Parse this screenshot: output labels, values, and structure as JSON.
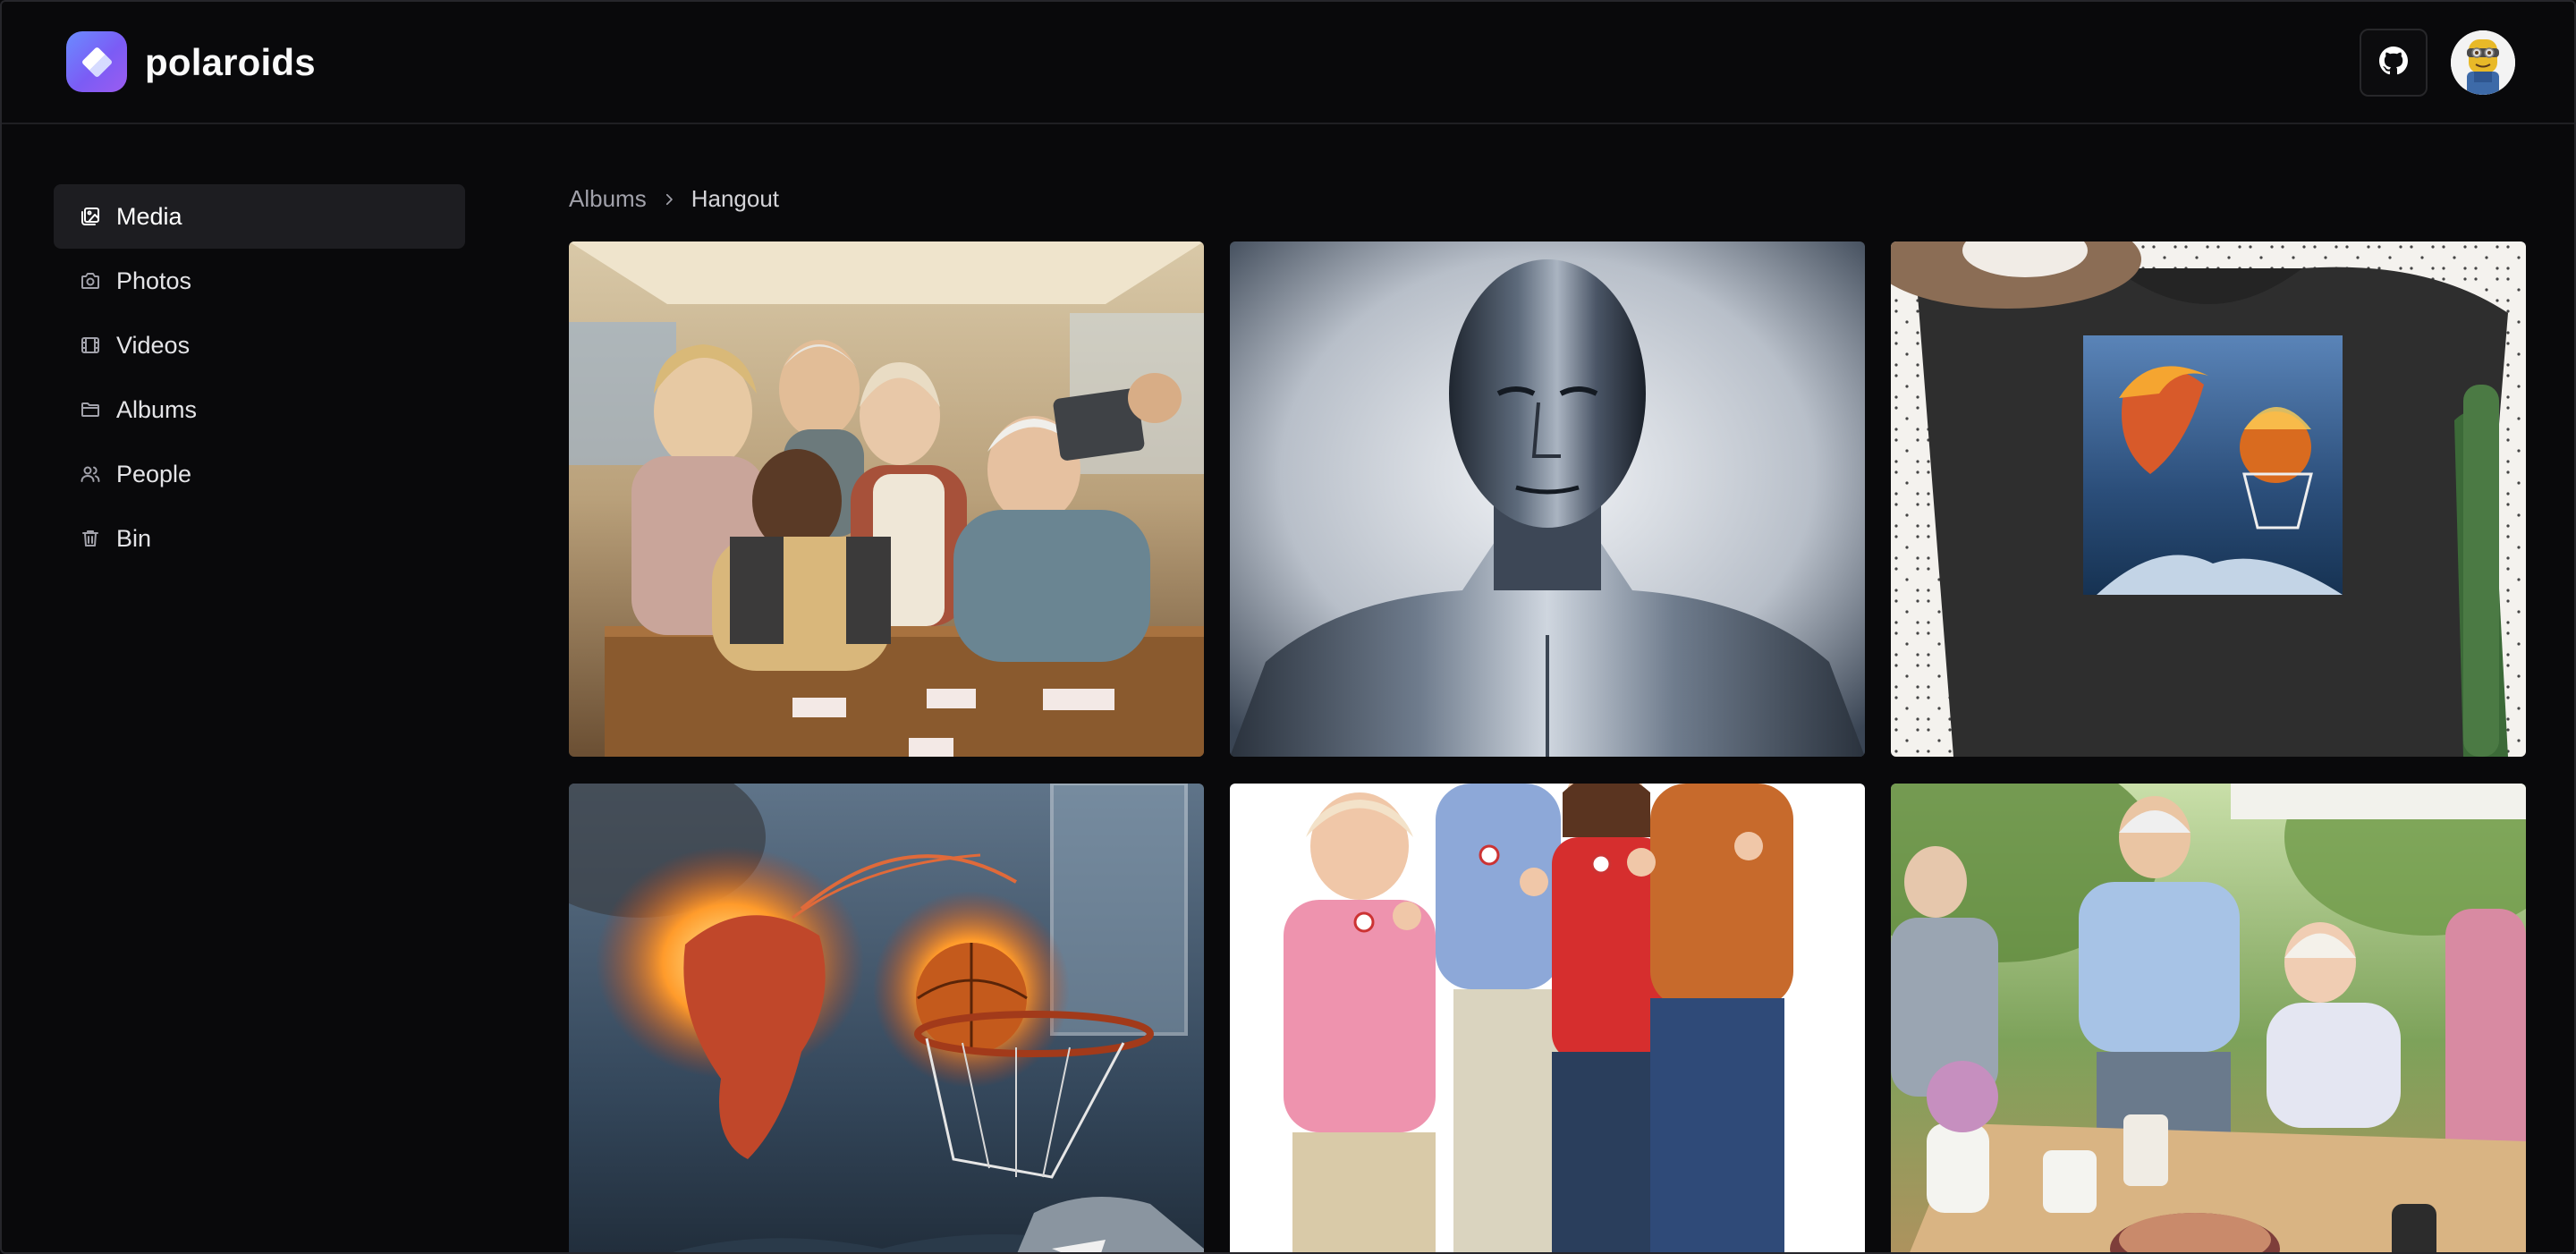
{
  "app": {
    "name": "polaroids"
  },
  "header": {
    "github_icon": "github-icon",
    "avatar_icon": "user-avatar"
  },
  "sidebar": {
    "items": [
      {
        "label": "Media",
        "icon": "media-icon",
        "active": true
      },
      {
        "label": "Photos",
        "icon": "camera-icon",
        "active": false
      },
      {
        "label": "Videos",
        "icon": "film-icon",
        "active": false
      },
      {
        "label": "Albums",
        "icon": "folder-icon",
        "active": false
      },
      {
        "label": "People",
        "icon": "people-icon",
        "active": false
      },
      {
        "label": "Bin",
        "icon": "trash-icon",
        "active": false
      }
    ]
  },
  "breadcrumb": {
    "items": [
      "Albums",
      "Hangout"
    ],
    "separator_icon": "chevron-right-icon"
  },
  "gallery": {
    "photos": [
      {
        "subject": "seniors-selfie-at-table"
      },
      {
        "subject": "chrome-bust-portrait"
      },
      {
        "subject": "sweatshirt-flaming-shrimp-print"
      },
      {
        "subject": "flaming-shrimp-basketball-shark"
      },
      {
        "subject": "seniors-thumbs-up"
      },
      {
        "subject": "seniors-outdoor-cafe"
      }
    ]
  },
  "colors": {
    "background": "#09090b",
    "sidebar_active": "#1d1d21",
    "border": "#1f1f23",
    "logo_gradient_start": "#6a8cff",
    "logo_gradient_end": "#9b5cf0"
  }
}
